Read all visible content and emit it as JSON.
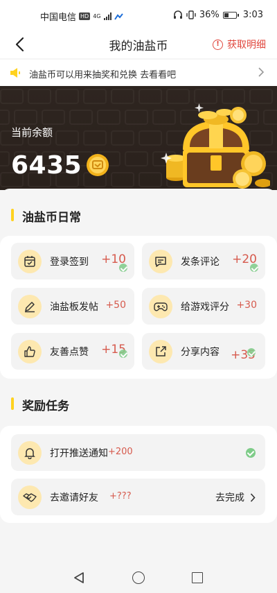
{
  "status_bar": {
    "carrier": "中国电信",
    "hd_badge": "HD",
    "network": "4G",
    "battery_percent": "36%",
    "battery_level": 0.36,
    "time": "3:03"
  },
  "header": {
    "title": "我的油盐币",
    "detail_label": "获取明细",
    "detail_icon": "!"
  },
  "notice": {
    "text": "油盐币可以用来抽奖和兑换 去看看吧"
  },
  "balance": {
    "label": "当前余额",
    "value": "6435"
  },
  "daily": {
    "title": "油盐币日常",
    "tasks": [
      {
        "label": "登录签到",
        "reward": "+10",
        "icon": "calendar-icon",
        "done": true
      },
      {
        "label": "发条评论",
        "reward": "+20",
        "icon": "comment-icon",
        "done": true
      },
      {
        "label": "油盐板发帖",
        "reward": "+50",
        "icon": "edit-icon",
        "done": false
      },
      {
        "label": "给游戏评分",
        "reward": "+30",
        "icon": "gamepad-icon",
        "done": false
      },
      {
        "label": "友善点赞",
        "reward": "+15",
        "icon": "thumbs-up-icon",
        "done": true
      },
      {
        "label": "分享内容",
        "reward": "+35",
        "icon": "share-icon",
        "done": true
      }
    ]
  },
  "rewards": {
    "title": "奖励任务",
    "tasks": [
      {
        "label": "打开推送通知",
        "reward": "+200",
        "icon": "bell-icon",
        "status": "done"
      },
      {
        "label": "去邀请好友",
        "reward": "+???",
        "icon": "handshake-icon",
        "action": "去完成"
      }
    ]
  },
  "colors": {
    "accent_yellow": "#ffd21f",
    "reward_red": "#d65a4d",
    "done_green": "#7fcc89",
    "banner_bg": "#2e2520"
  }
}
